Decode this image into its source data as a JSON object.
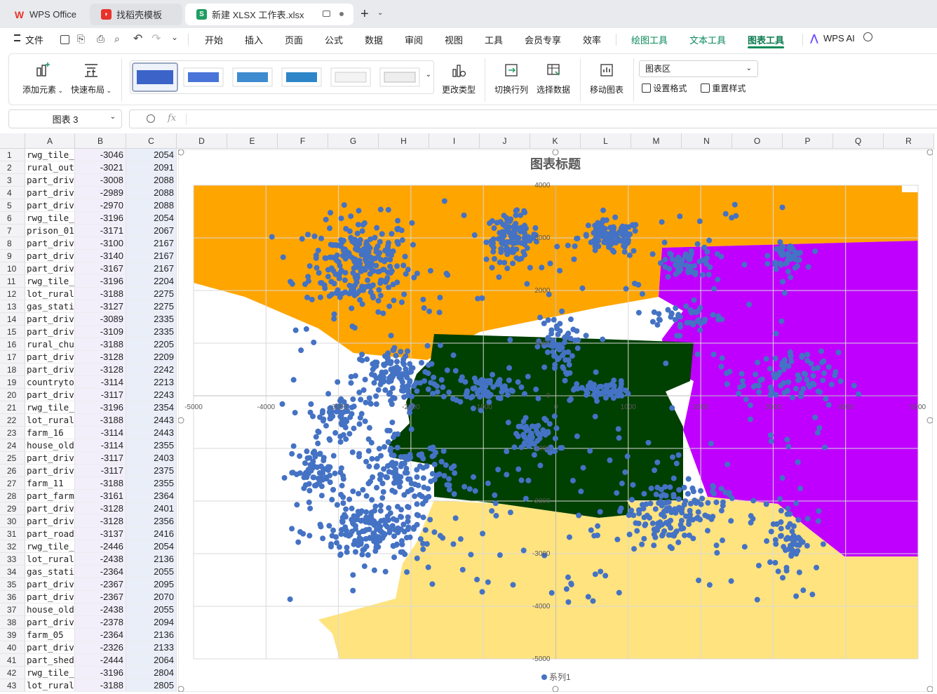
{
  "tabs": [
    {
      "label": "WPS Office",
      "icon": "wps-logo-icon"
    },
    {
      "label": "找稻壳模板",
      "icon": "docer-icon"
    },
    {
      "label": "新建 XLSX 工作表.xlsx",
      "icon": "spreadsheet-s-icon",
      "icon_letter": "S"
    }
  ],
  "menu": {
    "file": "文件",
    "items": [
      "开始",
      "插入",
      "页面",
      "公式",
      "数据",
      "审阅",
      "视图",
      "工具",
      "会员专享",
      "效率"
    ],
    "context_items": [
      "绘图工具",
      "文本工具",
      "图表工具"
    ],
    "ai": "WPS AI",
    "accent": "#0b8a5a"
  },
  "ribbon": {
    "add_element": "添加元素",
    "quick_layout": "快速布局",
    "change_type": "更改类型",
    "switch_rowcol": "切换行列",
    "select_data": "选择数据",
    "move_chart": "移动图表",
    "area_select": "图表区",
    "set_format": "设置格式",
    "reset_style": "重置样式"
  },
  "formula": {
    "namebox": "图表 3",
    "fx": "fx"
  },
  "columns": [
    "A",
    "B",
    "C",
    "D",
    "E",
    "F",
    "G",
    "H",
    "I",
    "J",
    "K",
    "L",
    "M",
    "N",
    "O",
    "P",
    "Q",
    "R"
  ],
  "rows": [
    {
      "n": 1,
      "a": "rwg_tile_",
      "b": "-3046",
      "c": "2054"
    },
    {
      "n": 2,
      "a": "rural_out",
      "b": "-3021",
      "c": "2091"
    },
    {
      "n": 3,
      "a": "part_driv",
      "b": "-3008",
      "c": "2088"
    },
    {
      "n": 4,
      "a": "part_driv",
      "b": "-2989",
      "c": "2088"
    },
    {
      "n": 5,
      "a": "part_driv",
      "b": "-2970",
      "c": "2088"
    },
    {
      "n": 6,
      "a": "rwg_tile_",
      "b": "-3196",
      "c": "2054"
    },
    {
      "n": 7,
      "a": "prison_01",
      "b": "-3171",
      "c": "2067"
    },
    {
      "n": 8,
      "a": "part_driv",
      "b": "-3100",
      "c": "2167"
    },
    {
      "n": 9,
      "a": "part_driv",
      "b": "-3140",
      "c": "2167"
    },
    {
      "n": 10,
      "a": "part_driv",
      "b": "-3167",
      "c": "2167"
    },
    {
      "n": 11,
      "a": "rwg_tile_",
      "b": "-3196",
      "c": "2204"
    },
    {
      "n": 12,
      "a": "lot_rural",
      "b": "-3188",
      "c": "2275"
    },
    {
      "n": 13,
      "a": "gas_stati",
      "b": "-3127",
      "c": "2275"
    },
    {
      "n": 14,
      "a": "part_driv",
      "b": "-3089",
      "c": "2335"
    },
    {
      "n": 15,
      "a": "part_driv",
      "b": "-3109",
      "c": "2335"
    },
    {
      "n": 16,
      "a": "rural_chu",
      "b": "-3188",
      "c": "2205"
    },
    {
      "n": 17,
      "a": "part_driv",
      "b": "-3128",
      "c": "2209"
    },
    {
      "n": 18,
      "a": "part_driv",
      "b": "-3128",
      "c": "2242"
    },
    {
      "n": 19,
      "a": "countryto",
      "b": "-3114",
      "c": "2213"
    },
    {
      "n": 20,
      "a": "part_driv",
      "b": "-3117",
      "c": "2243"
    },
    {
      "n": 21,
      "a": "rwg_tile_",
      "b": "-3196",
      "c": "2354"
    },
    {
      "n": 22,
      "a": "lot_rural",
      "b": "-3188",
      "c": "2443"
    },
    {
      "n": 23,
      "a": "farm_16",
      "b": "-3114",
      "c": "2443"
    },
    {
      "n": 24,
      "a": "house_old",
      "b": "-3114",
      "c": "2355"
    },
    {
      "n": 25,
      "a": "part_driv",
      "b": "-3117",
      "c": "2403"
    },
    {
      "n": 26,
      "a": "part_driv",
      "b": "-3117",
      "c": "2375"
    },
    {
      "n": 27,
      "a": "farm_11",
      "b": "-3188",
      "c": "2355"
    },
    {
      "n": 28,
      "a": "part_farm",
      "b": "-3161",
      "c": "2364"
    },
    {
      "n": 29,
      "a": "part_driv",
      "b": "-3128",
      "c": "2401"
    },
    {
      "n": 30,
      "a": "part_driv",
      "b": "-3128",
      "c": "2356"
    },
    {
      "n": 31,
      "a": "part_road",
      "b": "-3137",
      "c": "2416"
    },
    {
      "n": 32,
      "a": "rwg_tile_",
      "b": "-2446",
      "c": "2054"
    },
    {
      "n": 33,
      "a": "lot_rural",
      "b": "-2438",
      "c": "2136"
    },
    {
      "n": 34,
      "a": "gas_stati",
      "b": "-2364",
      "c": "2055"
    },
    {
      "n": 35,
      "a": "part_driv",
      "b": "-2367",
      "c": "2095"
    },
    {
      "n": 36,
      "a": "part_driv",
      "b": "-2367",
      "c": "2070"
    },
    {
      "n": 37,
      "a": "house_old",
      "b": "-2438",
      "c": "2055"
    },
    {
      "n": 38,
      "a": "part_driv",
      "b": "-2378",
      "c": "2094"
    },
    {
      "n": 39,
      "a": "farm_05",
      "b": "-2364",
      "c": "2136"
    },
    {
      "n": 40,
      "a": "part_driv",
      "b": "-2326",
      "c": "2133"
    },
    {
      "n": 41,
      "a": "part_shed",
      "b": "-2444",
      "c": "2064"
    },
    {
      "n": 42,
      "a": "rwg_tile_",
      "b": "-3196",
      "c": "2804"
    },
    {
      "n": 43,
      "a": "lot_rural",
      "b": "-3188",
      "c": "2805"
    }
  ],
  "chart_data": {
    "type": "scatter",
    "title": "图表标题",
    "xlim": [
      -5000,
      5000
    ],
    "ylim": [
      -5000,
      4000
    ],
    "x_ticks": [
      -5000,
      -4000,
      -3000,
      -2000,
      -1000,
      0,
      1000,
      2000,
      3000,
      4000,
      5000
    ],
    "y_ticks": [
      4000,
      3000,
      2000,
      1000,
      0,
      -1000,
      -2000,
      -3000,
      -4000,
      -5000
    ],
    "legend": "bottom",
    "grid": true,
    "series": [
      {
        "name": "系列1",
        "color": "#4472c4",
        "clusters": [
          {
            "cx": -2700,
            "cy": 2500,
            "sx": 350,
            "sy": 450,
            "n": 240
          },
          {
            "cx": -600,
            "cy": 3000,
            "sx": 180,
            "sy": 220,
            "n": 110
          },
          {
            "cx": 750,
            "cy": 3000,
            "sx": 220,
            "sy": 160,
            "n": 100
          },
          {
            "cx": 1850,
            "cy": 2550,
            "sx": 180,
            "sy": 140,
            "n": 50
          },
          {
            "cx": 3200,
            "cy": 2650,
            "sx": 120,
            "sy": 120,
            "n": 50
          },
          {
            "cx": -2200,
            "cy": 350,
            "sx": 300,
            "sy": 300,
            "n": 130
          },
          {
            "cx": -1000,
            "cy": 150,
            "sx": 220,
            "sy": 140,
            "n": 70
          },
          {
            "cx": 0,
            "cy": 950,
            "sx": 130,
            "sy": 280,
            "n": 60
          },
          {
            "cx": 650,
            "cy": 100,
            "sx": 180,
            "sy": 90,
            "n": 60
          },
          {
            "cx": -300,
            "cy": -800,
            "sx": 170,
            "sy": 200,
            "n": 60
          },
          {
            "cx": -3000,
            "cy": -400,
            "sx": 200,
            "sy": 200,
            "n": 60
          },
          {
            "cx": -3300,
            "cy": -1450,
            "sx": 200,
            "sy": 220,
            "n": 70
          },
          {
            "cx": -2100,
            "cy": -1450,
            "sx": 350,
            "sy": 300,
            "n": 130
          },
          {
            "cx": -2500,
            "cy": -2600,
            "sx": 400,
            "sy": 300,
            "n": 180
          },
          {
            "cx": 1550,
            "cy": -2200,
            "sx": 400,
            "sy": 300,
            "n": 150
          },
          {
            "cx": 3200,
            "cy": 300,
            "sx": 350,
            "sy": 260,
            "n": 80
          },
          {
            "cx": 3200,
            "cy": -2700,
            "sx": 120,
            "sy": 350,
            "n": 50
          },
          {
            "cx": 1800,
            "cy": 1500,
            "sx": 250,
            "sy": 150,
            "n": 40
          }
        ]
      }
    ],
    "background_regions": [
      {
        "name": "orange",
        "color": "#ffa500"
      },
      {
        "name": "purple",
        "color": "#bf00ff"
      },
      {
        "name": "dark-green",
        "color": "#004000"
      },
      {
        "name": "light-yellow",
        "color": "#ffe37f"
      }
    ]
  }
}
